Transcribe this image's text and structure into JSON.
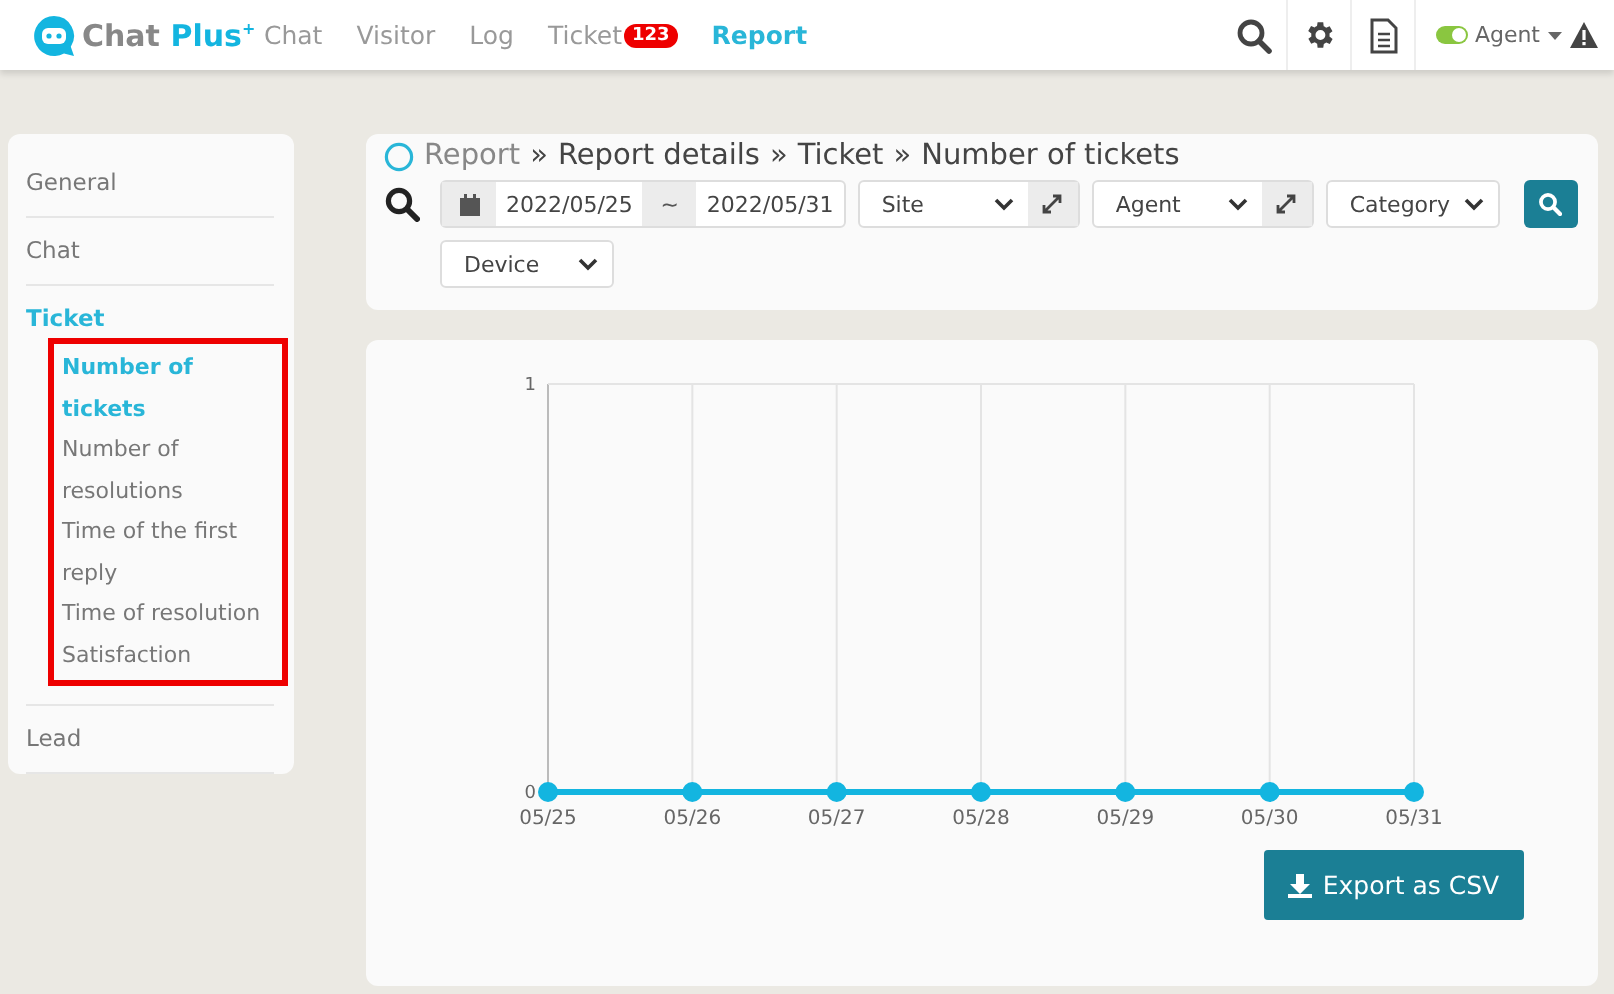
{
  "header": {
    "logo": {
      "name": "Chat",
      "accent": "Plus",
      "mark": "+"
    },
    "nav": [
      {
        "label": "Chat",
        "selected": false
      },
      {
        "label": "Visitor",
        "selected": false
      },
      {
        "label": "Log",
        "selected": false
      },
      {
        "label": "Ticket",
        "selected": false,
        "badge": "123"
      },
      {
        "label": "Report",
        "selected": true
      }
    ],
    "agent": {
      "label": "Agent",
      "online": true
    }
  },
  "sidebar": {
    "items": [
      {
        "label": "General",
        "selected": false
      },
      {
        "label": "Chat",
        "selected": false
      },
      {
        "label": "Ticket",
        "selected": true,
        "highlighted": true,
        "children": [
          {
            "label": "Number of tickets",
            "selected": true
          },
          {
            "label": "Number of resolutions",
            "selected": false
          },
          {
            "label": "Time of the first reply",
            "selected": false
          },
          {
            "label": "Time of resolution",
            "selected": false
          },
          {
            "label": "Satisfaction",
            "selected": false
          }
        ]
      },
      {
        "label": "Lead",
        "selected": false
      }
    ]
  },
  "breadcrumb": {
    "separator": "»",
    "items": [
      "Report",
      "Report details",
      "Ticket",
      "Number of tickets"
    ]
  },
  "filters": {
    "date_from": "2022/05/25",
    "range_sign": "~",
    "date_to": "2022/05/31",
    "selects": [
      {
        "label": "Site",
        "expand": true
      },
      {
        "label": "Agent",
        "expand": true
      },
      {
        "label": "Category",
        "expand": false
      },
      {
        "label": "Device",
        "expand": false
      }
    ]
  },
  "chart": {
    "chart_data": {
      "type": "line",
      "categories": [
        "05/25",
        "05/26",
        "05/27",
        "05/28",
        "05/29",
        "05/30",
        "05/31"
      ],
      "series": [
        {
          "color": "#13b5e0",
          "marker": "circle",
          "values": [
            0,
            0,
            0,
            0,
            0,
            0,
            0
          ]
        }
      ],
      "ylim": [
        0,
        1
      ],
      "yticks": [
        0,
        1
      ],
      "grid": true
    }
  },
  "export_button": "Export as CSV"
}
